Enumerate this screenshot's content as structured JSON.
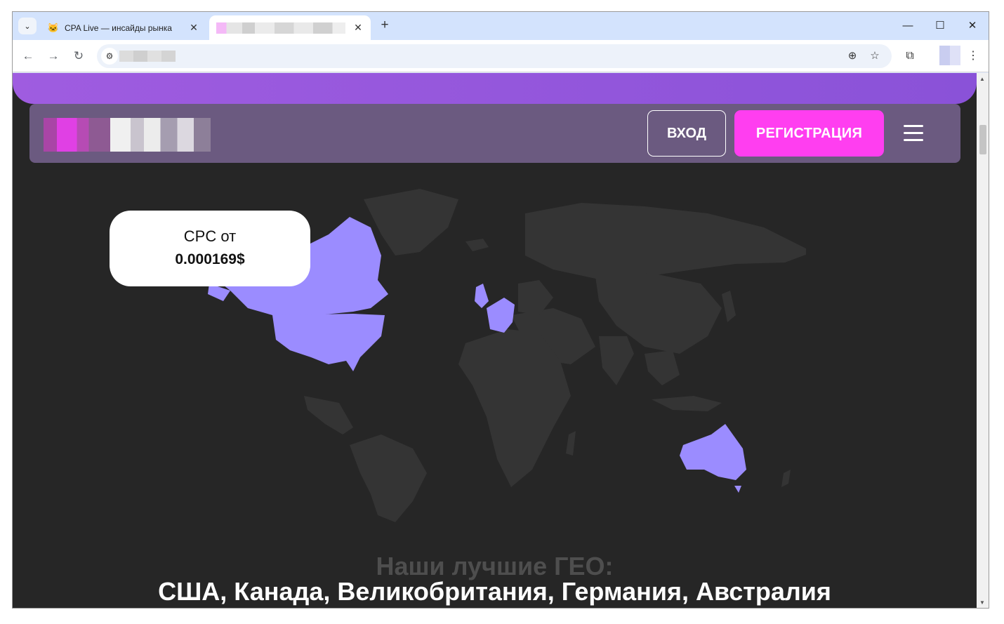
{
  "browser": {
    "tabs": [
      {
        "title": "CPA Live — инсайды рынка",
        "active": false
      },
      {
        "title": "",
        "active": true
      }
    ],
    "icons": {
      "tab_menu": "chevron-down-icon",
      "back": "arrow-left-icon",
      "forward": "arrow-right-icon",
      "reload": "reload-icon",
      "site_info": "tune-icon",
      "zoom": "zoom-icon",
      "bookmark": "star-icon",
      "extensions": "puzzle-icon",
      "menu": "kebab-menu-icon"
    },
    "glyphs": {
      "tab_menu": "⌄",
      "fav": "🐱",
      "close": "✕",
      "newtab": "+",
      "minimize": "—",
      "maximize": "☐",
      "win_close": "✕",
      "back": "←",
      "forward": "→",
      "reload": "↻",
      "site": "⚙",
      "zoom": "⊕",
      "star": "☆",
      "ext": "⧉",
      "kebab": "⋮",
      "scroll_up": "▲",
      "scroll_down": "▼"
    }
  },
  "header": {
    "login_label": "ВХОД",
    "register_label": "РЕГИСТРАЦИЯ"
  },
  "cpc": {
    "label": "CPC от",
    "value": "0.000169$"
  },
  "geo": {
    "title": "Наши лучшие ГЕО:",
    "countries": "США, Канада, Великобритания, Германия, Австралия"
  },
  "colors": {
    "page_bg": "#262626",
    "land": "#3a3a3a",
    "highlight": "#9b8cff",
    "register": "#ff3ef0",
    "header_bg": "#6b5a80",
    "banner": "#9f5ce0"
  }
}
